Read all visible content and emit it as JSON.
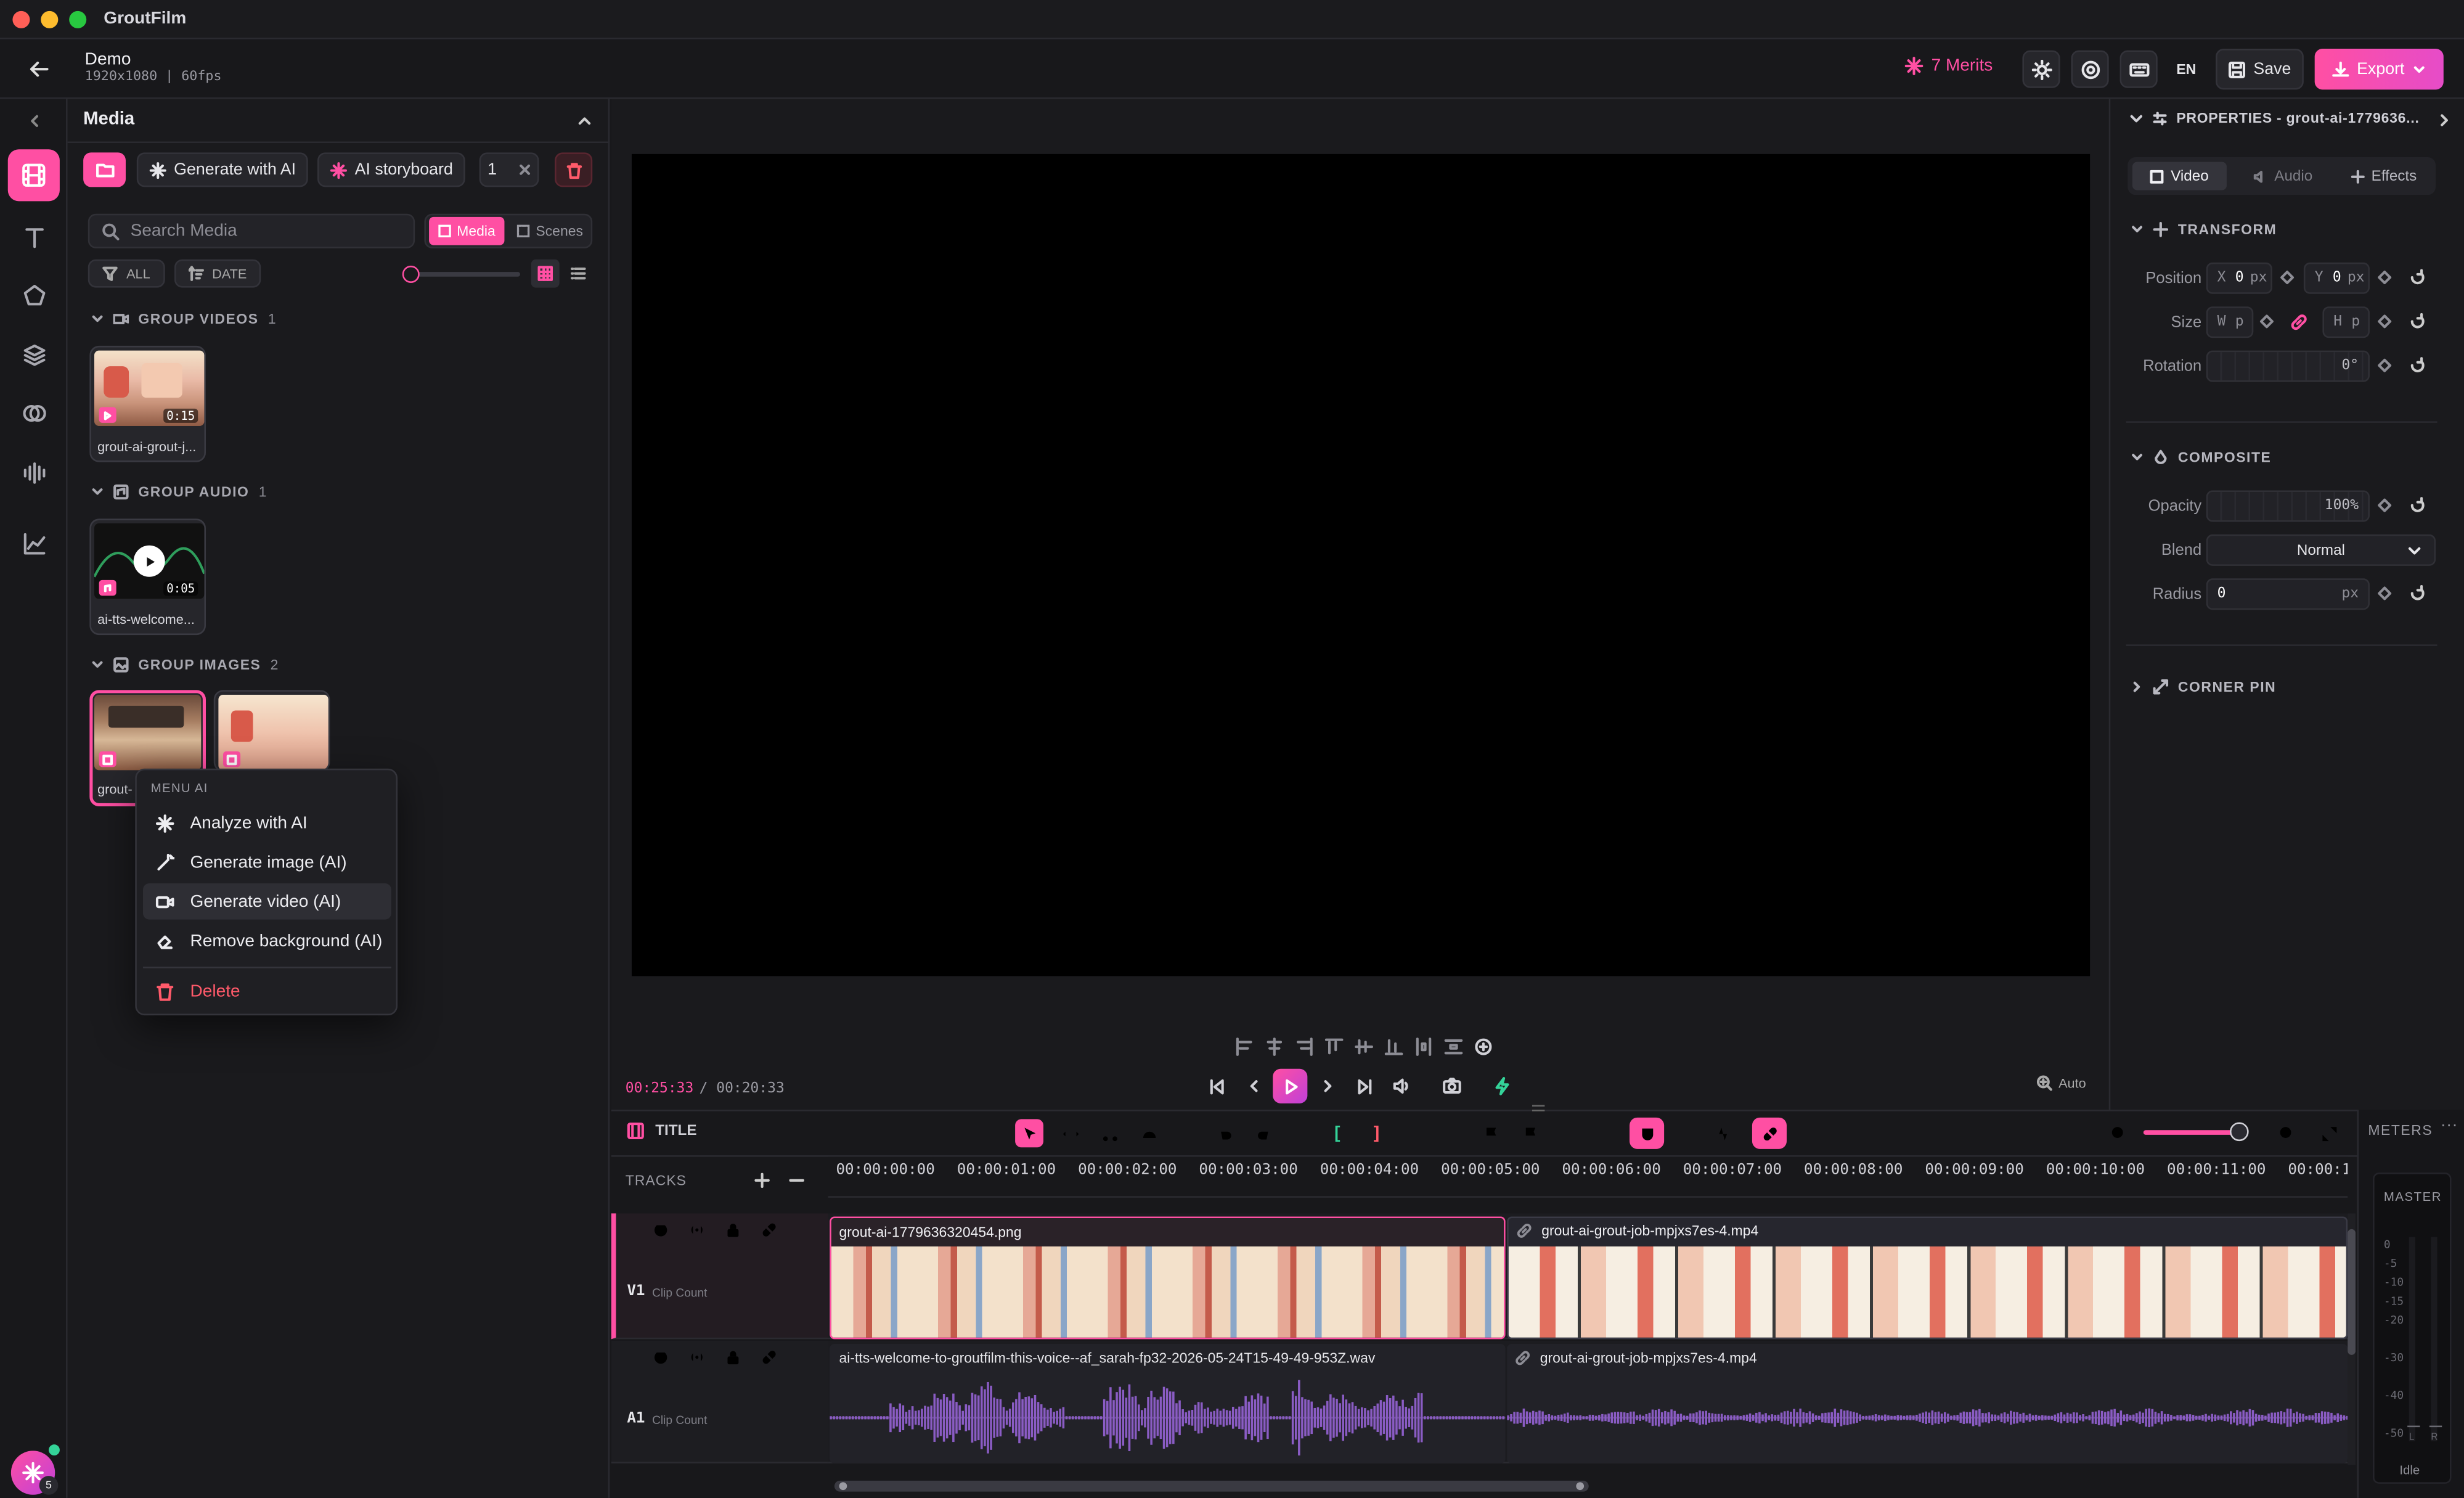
{
  "window": {
    "title": "GroutFilm"
  },
  "header": {
    "project_name": "Demo",
    "project_meta": "1920x1080 | 60fps",
    "merits": "7 Merits",
    "lang": "EN",
    "save_label": "Save",
    "export_label": "Export"
  },
  "sidebar": {
    "icons": [
      "media-icon",
      "text-icon",
      "shapes-icon",
      "layers-icon",
      "effects-icon",
      "audio-icon",
      "analytics-icon"
    ],
    "badge_count": "5"
  },
  "media": {
    "title": "Media",
    "generate_ai_label": "Generate with AI",
    "storyboard_label": "AI storyboard",
    "selection_count": "1",
    "search_placeholder": "Search Media",
    "tab_media": "Media",
    "tab_scenes": "Scenes",
    "filter_all": "ALL",
    "filter_date": "DATE",
    "groups": {
      "videos": {
        "label": "GROUP VIDEOS",
        "count": "1",
        "item_name": "grout-ai-grout-j...",
        "duration": "0:15"
      },
      "audio": {
        "label": "GROUP AUDIO",
        "count": "1",
        "item_name": "ai-tts-welcome...",
        "duration": "0:05"
      },
      "images": {
        "label": "GROUP IMAGES",
        "count": "2",
        "item_name": "grout-"
      }
    }
  },
  "context_menu": {
    "header": "MENU AI",
    "items": [
      "Analyze with AI",
      "Generate image (AI)",
      "Generate video (AI)",
      "Remove background (AI)"
    ],
    "delete_label": "Delete"
  },
  "player": {
    "current_time": "00:25:33",
    "total_time": "/ 00:20:33",
    "zoom_label": "Auto"
  },
  "properties": {
    "header": "PROPERTIES - grout-ai-1779636...",
    "tabs": [
      "Video",
      "Audio",
      "Effects"
    ],
    "transform_label": "TRANSFORM",
    "position_label": "Position",
    "pos_x_label": "X",
    "pos_x": "0",
    "pos_y_label": "Y",
    "pos_y": "0",
    "unit_px": "px",
    "size_label": "Size",
    "size_w_label": "W",
    "size_h_label": "H",
    "unit_p": "p",
    "rotation_label": "Rotation",
    "rotation": "0°",
    "composite_label": "COMPOSITE",
    "opacity_label": "Opacity",
    "opacity": "100%",
    "blend_label": "Blend",
    "blend_value": "Normal",
    "radius_label": "Radius",
    "radius": "0",
    "corner_pin_label": "CORNER PIN"
  },
  "timeline": {
    "title": "TITLE",
    "tracks_label": "TRACKS",
    "meters_label": "METERS",
    "ticks": [
      "00:00:00:00",
      "00:00:01:00",
      "00:00:02:00",
      "00:00:03:00",
      "00:00:04:00",
      "00:00:05:00",
      "00:00:06:00",
      "00:00:07:00",
      "00:00:08:00",
      "00:00:09:00",
      "00:00:10:00",
      "00:00:11:00",
      "00:00:1"
    ],
    "v1": {
      "name": "V1",
      "sub": "Clip Count",
      "clip1": "grout-ai-1779636320454.png",
      "clip2": "grout-ai-grout-job-mpjxs7es-4.mp4"
    },
    "a1": {
      "name": "A1",
      "sub": "Clip Count",
      "clip1": "ai-tts-welcome-to-groutfilm-this-voice--af_sarah-fp32-2026-05-24T15-49-49-953Z.wav",
      "clip2": "grout-ai-grout-job-mpjxs7es-4.mp4"
    },
    "meter": {
      "master": "MASTER",
      "scale": [
        "0",
        "-5",
        "-10",
        "-15",
        "-20",
        "-30",
        "-40",
        "-50"
      ],
      "status": "Idle",
      "channels": [
        "L",
        "R"
      ]
    }
  },
  "colors": {
    "accent": "#ff4fa3",
    "accent2": "#e040c8",
    "bg": "#18181b",
    "panel": "#1d1d21",
    "waveform": "#8a5cc4"
  }
}
